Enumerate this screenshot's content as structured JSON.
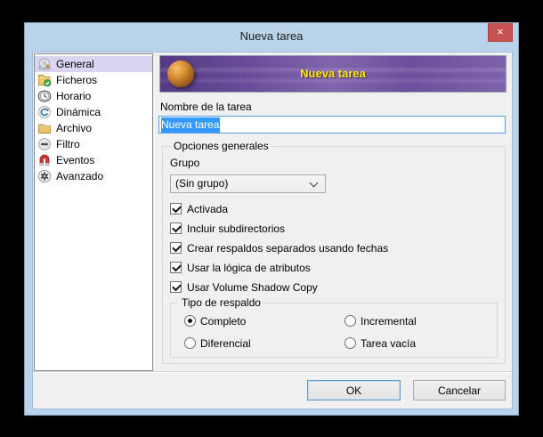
{
  "window": {
    "title": "Nueva tarea"
  },
  "icons": {
    "close_glyph": "×"
  },
  "colors": {
    "chrome_blue": "#b8d3ea",
    "close_red": "#c85151",
    "content_gray": "#f0f0f0",
    "selection_lavender": "#d8d4f2",
    "banner_purple": "#6c4f9c",
    "banner_text_yellow": "#ffec00",
    "focus_blue": "#569de5",
    "text_selection_blue": "#3399ff"
  },
  "sidebar": {
    "items": [
      {
        "label": "General",
        "icon": "disc-burner-icon",
        "selected": true
      },
      {
        "label": "Ficheros",
        "icon": "folder-check-icon",
        "selected": false
      },
      {
        "label": "Horario",
        "icon": "clock-icon",
        "selected": false
      },
      {
        "label": "Dinámica",
        "icon": "refresh-icon",
        "selected": false
      },
      {
        "label": "Archivo",
        "icon": "folder-icon",
        "selected": false
      },
      {
        "label": "Filtro",
        "icon": "minus-circle-icon",
        "selected": false
      },
      {
        "label": "Eventos",
        "icon": "magnet-icon",
        "selected": false
      },
      {
        "label": "Avanzado",
        "icon": "gear-circle-icon",
        "selected": false
      }
    ]
  },
  "main": {
    "banner": {
      "title": "Nueva tarea"
    },
    "name_field": {
      "label": "Nombre de la tarea",
      "value": "Nueva tarea",
      "selected": true
    },
    "options_group": {
      "title": "Opciones generales",
      "group_label": "Grupo",
      "group_value": "(Sin grupo)",
      "checkboxes": [
        {
          "label": "Activada",
          "checked": true
        },
        {
          "label": "Incluir subdirectorios",
          "checked": true
        },
        {
          "label": "Crear respaldos separados usando fechas",
          "checked": true
        },
        {
          "label": "Usar la lógica de atributos",
          "checked": true
        },
        {
          "label": "Usar Volume Shadow Copy",
          "checked": true
        }
      ],
      "backup_type": {
        "title": "Tipo de respaldo",
        "options": [
          {
            "label": "Completo",
            "selected": true
          },
          {
            "label": "Incremental",
            "selected": false
          },
          {
            "label": "Diferencial",
            "selected": false
          },
          {
            "label": "Tarea vacía",
            "selected": false
          }
        ]
      }
    }
  },
  "footer": {
    "ok_label": "OK",
    "cancel_label": "Cancelar"
  }
}
